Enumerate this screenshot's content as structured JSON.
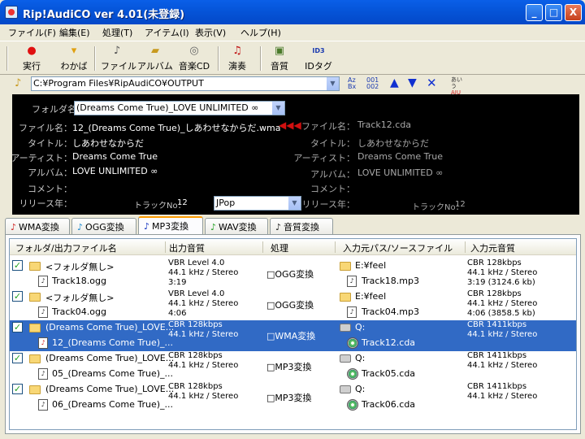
{
  "window": {
    "title": "Rip!AudiCO ver 4.01(未登録)",
    "btn_min": "_",
    "btn_max": "□",
    "btn_close": "X"
  },
  "menu": [
    "ファイル(F)",
    "編集(E)",
    "処理(T)",
    "アイテム(I)",
    "表示(V)",
    "ヘルプ(H)"
  ],
  "toolbar": [
    {
      "label": "実行",
      "icon": "red-dot-icon"
    },
    {
      "label": "わかば",
      "icon": "wakaba-icon"
    },
    {
      "label": "ファイル",
      "icon": "file-icon"
    },
    {
      "label": "アルバム",
      "icon": "album-icon"
    },
    {
      "label": "音楽CD",
      "icon": "cd-icon"
    },
    {
      "label": "演奏",
      "icon": "play-icon"
    },
    {
      "label": "音質",
      "icon": "quality-icon"
    },
    {
      "label": "IDタグ",
      "icon": "id3-icon"
    }
  ],
  "path": {
    "value": "C:¥Program Files¥RipAudiCO¥OUTPUT"
  },
  "sort_icons": {
    "az": "Az",
    "za": "Bx",
    "n1": "001",
    "n2": "002",
    "aiu1": "あいう",
    "aiu2": "AIU"
  },
  "info": {
    "folder_label": "フォルダ名：",
    "folder_value": "(Dreams Come True)_LOVE UNLIMITED ∞",
    "file_label": "ファイル名：",
    "file_value": "12_(Dreams Come True)_しあわせなからだ.wma",
    "title_label": "タイトル：",
    "title_value": "しあわせなからだ",
    "artist_label": "アーティスト：",
    "artist_value": "Dreams Come True",
    "album_label": "アルバム：",
    "album_value": "LOVE UNLIMITED ∞",
    "comment_label": "コメント：",
    "comment_value": "",
    "year_label": "リリース年：",
    "track_label": "トラックNo：",
    "track_value": "12",
    "genre_value": "JPop",
    "src_file_label": "ファイル名：",
    "src_file_value": "Track12.cda",
    "src_title_label": "タイトル：",
    "src_title_value": "しあわせなからだ",
    "src_artist_label": "アーティスト：",
    "src_artist_value": "Dreams Come True",
    "src_album_label": "アルバム：",
    "src_album_value": "LOVE UNLIMITED ∞",
    "src_comment_label": "コメント：",
    "src_year_label": "リリース年：",
    "src_track_label": "トラックNo：",
    "src_track_value": "12"
  },
  "tabs": [
    {
      "label": "WMA変換",
      "color": "#d02020"
    },
    {
      "label": "OGG変換",
      "color": "#1a8ad0"
    },
    {
      "label": "MP3変換",
      "color": "#1030c0"
    },
    {
      "label": "WAV変換",
      "color": "#20a020"
    },
    {
      "label": "音質変換",
      "color": "#202020"
    }
  ],
  "columns": [
    "フォルダ/出力ファイル名",
    "出力音質",
    "処理",
    "入力元パス/ソースファイル",
    "入力元音質"
  ],
  "rows": [
    {
      "folder": "<フォルダ無し>",
      "file": "Track18.ogg",
      "q1": "VBR  Level 4.0",
      "q2": "44.1 kHz / Stereo",
      "q3": "3:19",
      "proc": "□OGG変換",
      "src_dir": "E:¥feel",
      "src_file": "Track18.mp3",
      "s1": "CBR 128kbps",
      "s2": "44.1 kHz / Stereo",
      "s3": "3:19 (3124.6 kb)"
    },
    {
      "folder": "<フォルダ無し>",
      "file": "Track04.ogg",
      "q1": "VBR  Level 4.0",
      "q2": "44.1 kHz / Stereo",
      "q3": "4:06",
      "proc": "□OGG変換",
      "src_dir": "E:¥feel",
      "src_file": "Track04.mp3",
      "s1": "CBR 128kbps",
      "s2": "44.1 kHz / Stereo",
      "s3": "4:06 (3858.5 kb)"
    },
    {
      "folder": "(Dreams Come True)_LOVE...",
      "file": "12_(Dreams Come True)_...",
      "q1": "CBR 128kbps",
      "q2": "44.1 kHz / Stereo",
      "q3": "",
      "proc": "□WMA変換",
      "src_dir": "Q:",
      "src_file": "Track12.cda",
      "s1": "CBR 1411kbps",
      "s2": "44.1 kHz / Stereo",
      "s3": ""
    },
    {
      "folder": "(Dreams Come True)_LOVE...",
      "file": "05_(Dreams Come True)_...",
      "q1": "CBR 128kbps",
      "q2": "44.1 kHz / Stereo",
      "q3": "",
      "proc": "□MP3変換",
      "src_dir": "Q:",
      "src_file": "Track05.cda",
      "s1": "CBR 1411kbps",
      "s2": "44.1 kHz / Stereo",
      "s3": ""
    },
    {
      "folder": "(Dreams Come True)_LOVE...",
      "file": "06_(Dreams Come True)_...",
      "q1": "CBR 128kbps",
      "q2": "44.1 kHz / Stereo",
      "q3": "",
      "proc": "□MP3変換",
      "src_dir": "Q:",
      "src_file": "Track06.cda",
      "s1": "CBR 1411kbps",
      "s2": "44.1 kHz / Stereo",
      "s3": ""
    }
  ]
}
